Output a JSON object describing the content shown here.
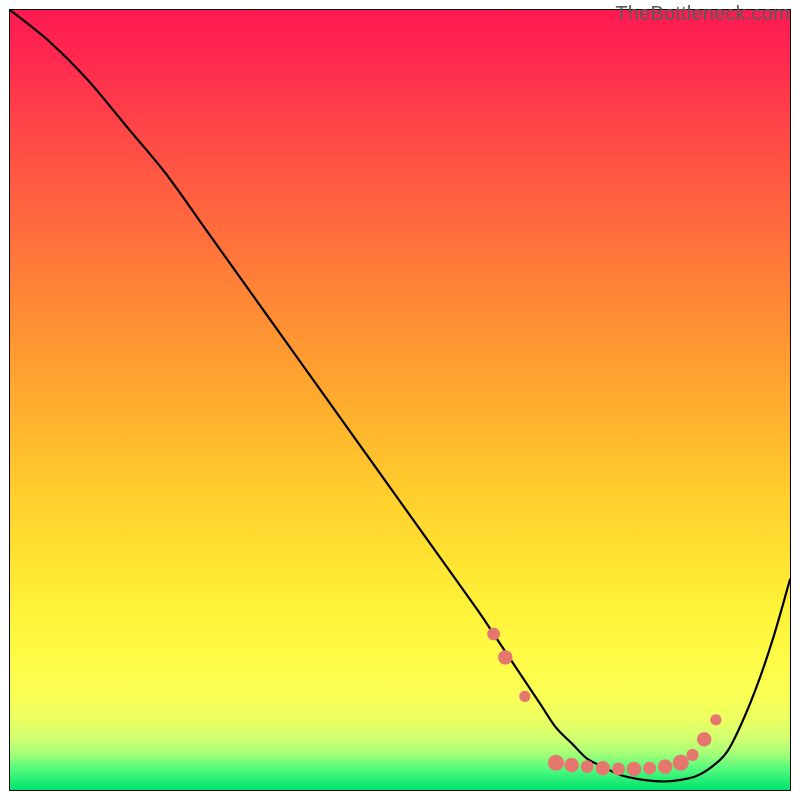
{
  "watermark": "TheBottleneck.com",
  "chart_data": {
    "type": "line",
    "title": "",
    "xlabel": "",
    "ylabel": "",
    "xlim": [
      0,
      100
    ],
    "ylim": [
      0,
      100
    ],
    "series": [
      {
        "name": "bottleneck-curve",
        "x": [
          0,
          5,
          10,
          15,
          20,
          25,
          30,
          35,
          40,
          45,
          50,
          55,
          60,
          62,
          64,
          66,
          68,
          70,
          72,
          74,
          76,
          78,
          80,
          82,
          84,
          86,
          88,
          90,
          92,
          94,
          96,
          98,
          100
        ],
        "y": [
          100,
          96,
          91,
          85,
          79,
          72,
          65,
          58,
          51,
          44,
          37,
          30,
          23,
          20,
          17,
          14,
          11,
          8,
          6,
          4,
          3,
          2,
          1.5,
          1.2,
          1.1,
          1.3,
          1.8,
          3,
          5,
          9,
          14,
          20,
          27
        ]
      }
    ],
    "markers": {
      "name": "highlighted-points",
      "color": "#e6776f",
      "points": [
        {
          "x": 62,
          "y": 20,
          "r": 4.0
        },
        {
          "x": 63.5,
          "y": 17,
          "r": 4.5
        },
        {
          "x": 66,
          "y": 12,
          "r": 3.5
        },
        {
          "x": 70,
          "y": 3.5,
          "r": 5.0
        },
        {
          "x": 72,
          "y": 3.2,
          "r": 4.5
        },
        {
          "x": 74,
          "y": 3.0,
          "r": 4.0
        },
        {
          "x": 76,
          "y": 2.8,
          "r": 4.5
        },
        {
          "x": 78,
          "y": 2.7,
          "r": 4.0
        },
        {
          "x": 80,
          "y": 2.7,
          "r": 4.5
        },
        {
          "x": 82,
          "y": 2.8,
          "r": 4.0
        },
        {
          "x": 84,
          "y": 3.0,
          "r": 4.5
        },
        {
          "x": 86,
          "y": 3.5,
          "r": 5.0
        },
        {
          "x": 87.5,
          "y": 4.5,
          "r": 3.8
        },
        {
          "x": 89,
          "y": 6.5,
          "r": 4.5
        },
        {
          "x": 90.5,
          "y": 9.0,
          "r": 3.5
        }
      ]
    },
    "gradient_stops": [
      {
        "offset": 0.0,
        "color": "#ff1a51"
      },
      {
        "offset": 0.06,
        "color": "#ff2850"
      },
      {
        "offset": 0.14,
        "color": "#ff4249"
      },
      {
        "offset": 0.22,
        "color": "#ff5a42"
      },
      {
        "offset": 0.3,
        "color": "#ff723b"
      },
      {
        "offset": 0.38,
        "color": "#ff8a35"
      },
      {
        "offset": 0.46,
        "color": "#ffa030"
      },
      {
        "offset": 0.54,
        "color": "#ffb72d"
      },
      {
        "offset": 0.62,
        "color": "#ffce2d"
      },
      {
        "offset": 0.7,
        "color": "#ffe231"
      },
      {
        "offset": 0.77,
        "color": "#fff23a"
      },
      {
        "offset": 0.83,
        "color": "#fffb46"
      },
      {
        "offset": 0.88,
        "color": "#faff55"
      },
      {
        "offset": 0.91,
        "color": "#eaff62"
      },
      {
        "offset": 0.935,
        "color": "#d0ff70"
      },
      {
        "offset": 0.955,
        "color": "#9fff79"
      },
      {
        "offset": 0.975,
        "color": "#4bf97c"
      },
      {
        "offset": 1.0,
        "color": "#00e36f"
      }
    ]
  }
}
